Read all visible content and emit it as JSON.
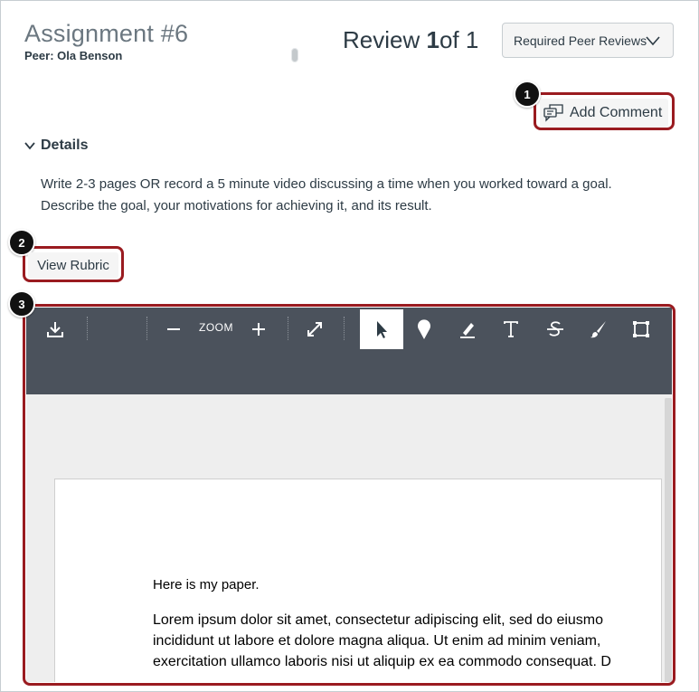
{
  "header": {
    "assignment_title": "Assignment #6",
    "peer_label": "Peer: Ola Benson",
    "review_prefix": "Review",
    "review_current": "1",
    "review_suffix": "of 1",
    "peer_select_value": "Required Peer Reviews"
  },
  "actions": {
    "add_comment_label": "Add Comment",
    "view_rubric_label": "View Rubric"
  },
  "details": {
    "toggle_label": "Details",
    "description_line1": "Write 2-3 pages OR record a 5 minute video discussing a time when you worked toward a goal.",
    "description_line2": "Describe the goal, your motivations for achieving it, and its result."
  },
  "callouts": {
    "badge_1": "1",
    "badge_2": "2",
    "badge_3": "3",
    "highlight_color": "#9a1b20"
  },
  "viewer": {
    "zoom_label": "ZOOM",
    "toolbar_icons": [
      "download-icon",
      "zoom-out-icon",
      "zoom-in-icon",
      "fullscreen-icon",
      "pointer-icon",
      "point-annotation-icon",
      "highlight-icon",
      "text-icon",
      "strikeout-icon",
      "freedraw-icon",
      "area-icon"
    ],
    "active_tool": "pointer-icon",
    "toolbar_color": "#4b525c",
    "document": {
      "line_intro": "Here is my paper.",
      "body_line1": "Lorem ipsum dolor sit amet, consectetur adipiscing elit, sed do eiusmo",
      "body_line2": "incididunt ut labore et dolore magna aliqua. Ut enim ad minim veniam,",
      "body_line3": "exercitation ullamco laboris nisi ut aliquip ex ea commodo consequat. D"
    }
  }
}
